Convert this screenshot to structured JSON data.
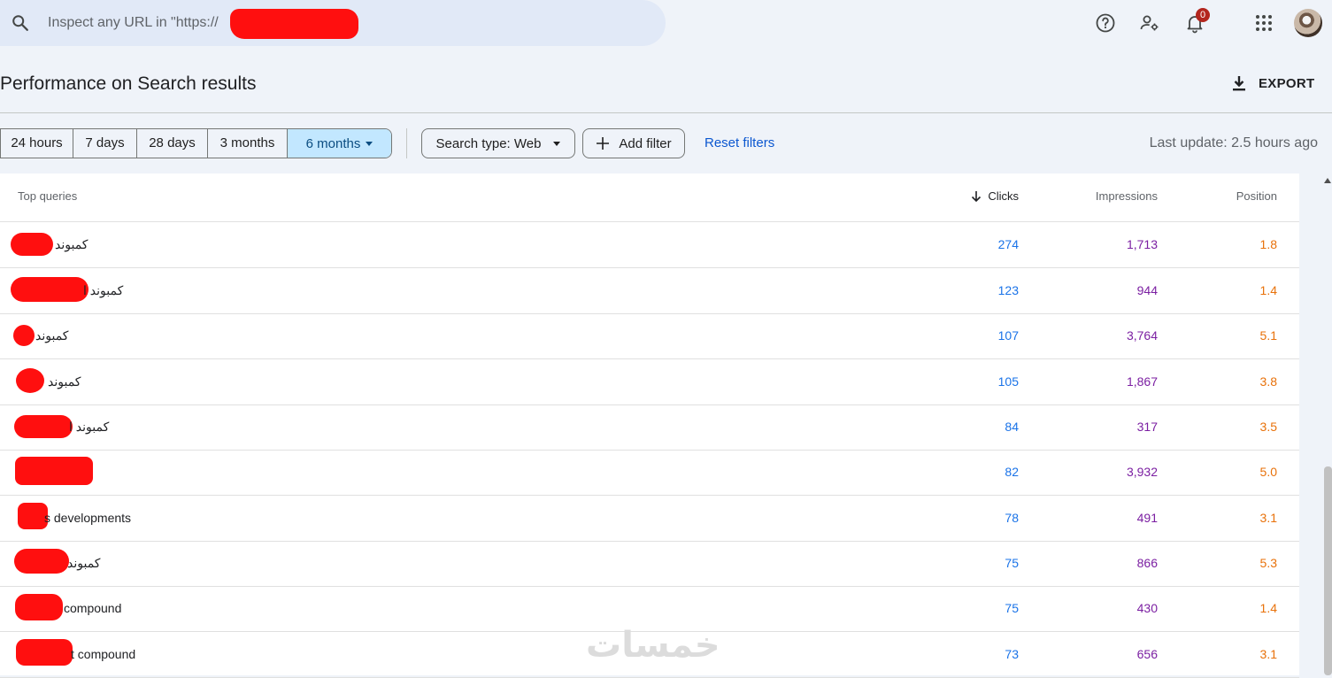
{
  "search": {
    "placeholder": "Inspect any URL in \"https://"
  },
  "topbar": {
    "icons": [
      "help-icon",
      "manage-users-icon",
      "notifications-icon",
      "apps-grid-icon"
    ],
    "notification_count": "0"
  },
  "header": {
    "title": "Performance on Search results",
    "export_label": "EXPORT"
  },
  "date_ranges": [
    "24 hours",
    "7 days",
    "28 days",
    "3 months",
    "6 months"
  ],
  "selected_range": "6 months",
  "filters": {
    "search_type": "Search type: Web",
    "add_filter": "Add filter",
    "reset": "Reset filters",
    "last_update": "Last update: 2.5 hours ago"
  },
  "table": {
    "headers": {
      "query": "Top queries",
      "clicks": "Clicks",
      "impressions": "Impressions",
      "position": "Position"
    },
    "sort": {
      "column": "Clicks",
      "direction": "descending"
    },
    "rows": [
      {
        "query": "كمبوند",
        "clicks": "274",
        "impressions": "1,713",
        "position": "1.8"
      },
      {
        "query": "كمبوند ا",
        "clicks": "123",
        "impressions": "944",
        "position": "1.4"
      },
      {
        "query": "كمبوند",
        "clicks": "107",
        "impressions": "3,764",
        "position": "5.1"
      },
      {
        "query": "كمبوند",
        "clicks": "105",
        "impressions": "1,867",
        "position": "3.8"
      },
      {
        "query": "كمبوند ا",
        "clicks": "84",
        "impressions": "317",
        "position": "3.5"
      },
      {
        "query": "",
        "clicks": "82",
        "impressions": "3,932",
        "position": "5.0"
      },
      {
        "query": "s developments",
        "clicks": "78",
        "impressions": "491",
        "position": "3.1"
      },
      {
        "query": "كمبوند",
        "clicks": "75",
        "impressions": "866",
        "position": "5.3"
      },
      {
        "query": "compound",
        "clicks": "75",
        "impressions": "430",
        "position": "1.4"
      },
      {
        "query": "t compound",
        "clicks": "73",
        "impressions": "656",
        "position": "3.1"
      }
    ]
  },
  "watermark": "خمسات"
}
